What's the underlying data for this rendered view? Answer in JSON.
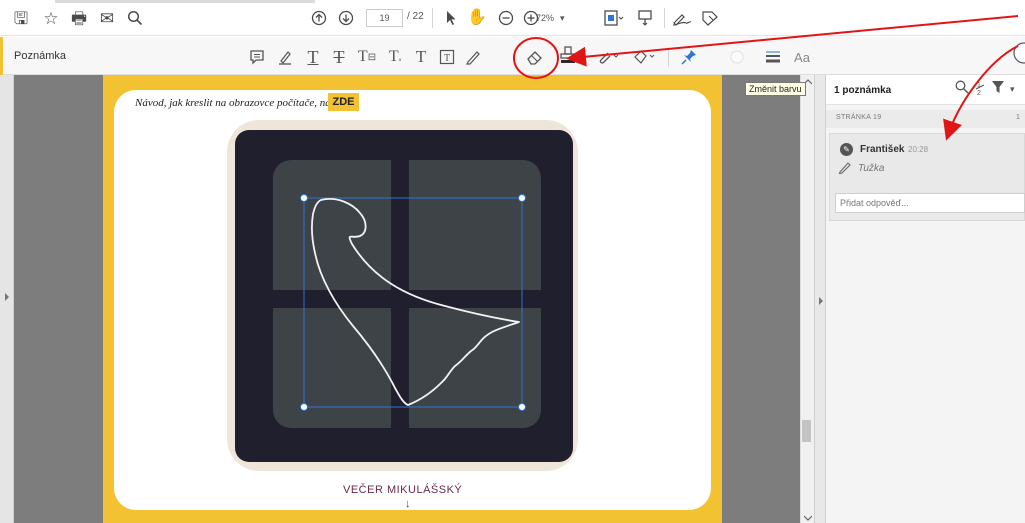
{
  "toolbar": {
    "page_current": "19",
    "page_total": "/ 22",
    "zoom": "72%",
    "zoom_caret": "▾"
  },
  "annotation_bar": {
    "title": "Poznámka",
    "font_label": "Aa"
  },
  "page": {
    "instruction": "Návod, jak kreslit na obrazovce počítače, najdeš",
    "link_label": "ZDE",
    "footer_title": "VEČER MIKULÁŠSKÝ",
    "footer_arrow": "↓"
  },
  "tooltip": "Změnit barvu",
  "comments_panel": {
    "count": "1 poznámka",
    "page_label": "STRÁNKA 19",
    "page_count": "1",
    "comment": {
      "author": "František",
      "time": "20:28",
      "tool": "Tužka",
      "reply_placeholder": "Přidat odpověď..."
    }
  },
  "colors": {
    "accent_yellow": "#f2c233",
    "callout_red": "#e01515",
    "window_frame": "#1f1f2e",
    "glass": "#3e4348",
    "selection_blue": "#2a76d2"
  }
}
